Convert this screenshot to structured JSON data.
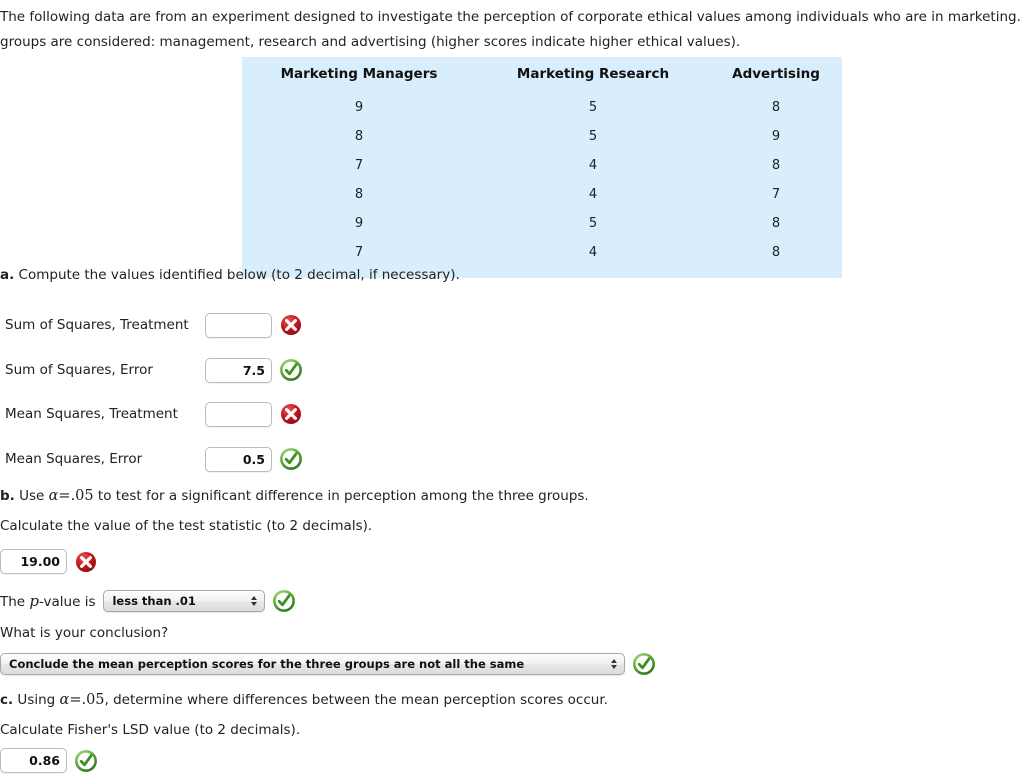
{
  "intro": {
    "line1": "The following data are from an experiment designed to investigate the perception of corporate ethical values among individuals who are in marketing. T",
    "line2": "groups are considered: management, research and advertising (higher scores indicate higher ethical values)."
  },
  "data_table": {
    "headers": [
      "Marketing Managers",
      "Marketing Research",
      "Advertising"
    ],
    "rows": [
      [
        "9",
        "5",
        "8"
      ],
      [
        "8",
        "5",
        "9"
      ],
      [
        "7",
        "4",
        "8"
      ],
      [
        "8",
        "4",
        "7"
      ],
      [
        "9",
        "5",
        "8"
      ],
      [
        "7",
        "4",
        "8"
      ]
    ]
  },
  "part_a": {
    "prompt_label": "a.",
    "prompt_text": " Compute the values identified below (to 2 decimal, if necessary).",
    "fields": [
      {
        "label": "Sum of Squares, Treatment",
        "value": "",
        "status": "incorrect"
      },
      {
        "label": "Sum of Squares, Error",
        "value": "7.5",
        "status": "correct"
      },
      {
        "label": "Mean Squares, Treatment",
        "value": "",
        "status": "incorrect"
      },
      {
        "label": "Mean Squares, Error",
        "value": "0.5",
        "status": "correct"
      }
    ]
  },
  "part_b": {
    "prompt_label": "b.",
    "prompt_pre": " Use ",
    "alpha_symbol": "α",
    "equals_symbol": "=",
    "alpha_value": ".05",
    "prompt_post": " to test for a significant difference in perception among the three groups.",
    "calc_text": "Calculate the value of the test statistic (to 2 decimals).",
    "test_statistic": {
      "value": "19.00",
      "status": "incorrect"
    },
    "pvalue_pre": "The ",
    "pvalue_p": "p",
    "pvalue_post": "-value is",
    "pvalue_select": {
      "value": "less than .01",
      "status": "correct"
    },
    "conclusion_question": "What is your conclusion?",
    "conclusion_select": {
      "value": "Conclude the mean perception scores for the three groups are not all the same",
      "status": "correct"
    }
  },
  "part_c": {
    "prompt_label": "c.",
    "prompt_pre": " Using ",
    "alpha_symbol": "α",
    "equals_symbol": "=",
    "alpha_value": ".05",
    "prompt_post": ", determine where differences between the mean perception scores occur.",
    "calc_text": "Calculate Fisher's LSD value (to 2 decimals).",
    "lsd": {
      "value": "0.86",
      "status": "correct"
    }
  },
  "colors": {
    "table_bg": "#d8eefc",
    "correct_green": "#3d8b29",
    "incorrect_red": "#b81b1b",
    "text": "#222222"
  },
  "icons": {
    "correct": "check-circle-icon",
    "incorrect": "x-circle-icon"
  }
}
